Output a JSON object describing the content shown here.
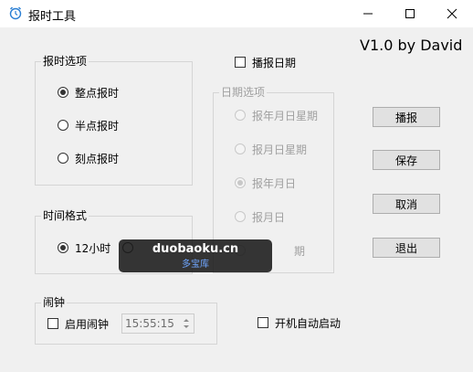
{
  "window": {
    "title": "报时工具",
    "version": "V1.0 by David"
  },
  "report_options": {
    "title": "报时选项",
    "options": [
      {
        "label": "整点报时",
        "checked": true
      },
      {
        "label": "半点报时",
        "checked": false
      },
      {
        "label": "刻点报时",
        "checked": false
      }
    ]
  },
  "report_date": {
    "label": "播报日期",
    "checked": false
  },
  "date_options": {
    "title": "日期选项",
    "options": [
      {
        "label": "报年月日星期",
        "checked": false
      },
      {
        "label": "报月日星期",
        "checked": false
      },
      {
        "label": "报年月日",
        "checked": true
      },
      {
        "label": "报月日",
        "checked": false
      },
      {
        "label": "期",
        "checked": false
      }
    ]
  },
  "time_format": {
    "title": "时间格式",
    "options": [
      {
        "label": "12小时",
        "checked": true
      },
      {
        "label": "",
        "checked": false
      }
    ]
  },
  "alarm": {
    "title": "闹钟",
    "enable_label": "启用闹钟",
    "enabled": false,
    "time_value": "15:55:15"
  },
  "autostart": {
    "label": "开机自动启动",
    "checked": false
  },
  "buttons": {
    "broadcast": "播报",
    "save": "保存",
    "cancel": "取消",
    "exit": "退出"
  },
  "watermark": {
    "main": "duobaoku.cn",
    "sub": "多宝库"
  }
}
